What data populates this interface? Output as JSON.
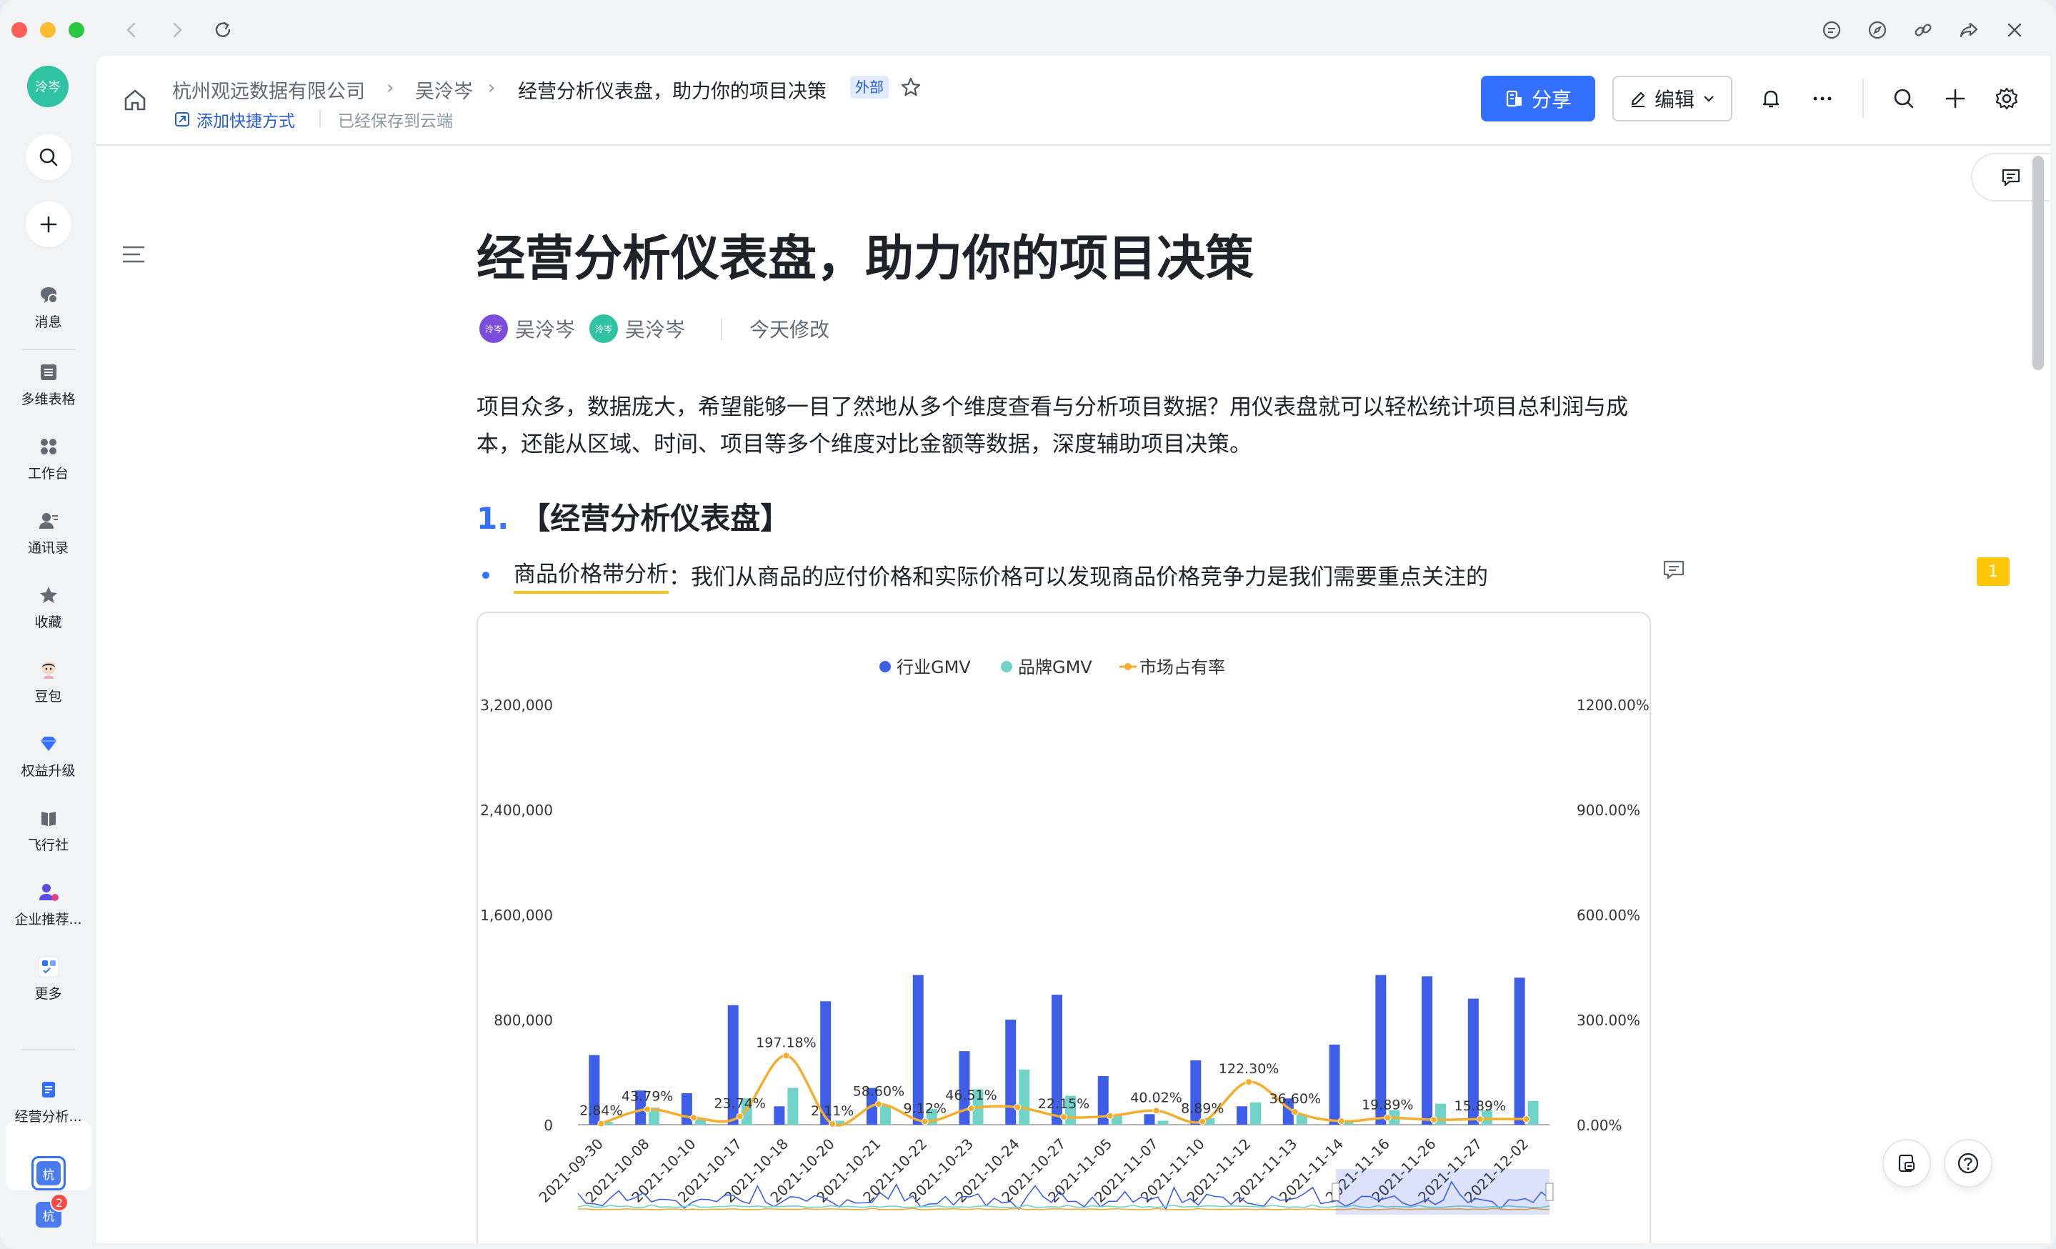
{
  "sidebar": {
    "avatar_text": "泠岑",
    "items": [
      {
        "label": "消息",
        "icon": "chat-bubble-icon"
      },
      {
        "label": "多维表格",
        "icon": "table-icon"
      },
      {
        "label": "工作台",
        "icon": "apps-grid-icon"
      },
      {
        "label": "通讯录",
        "icon": "contacts-icon"
      },
      {
        "label": "收藏",
        "icon": "star-icon"
      },
      {
        "label": "豆包",
        "icon": "doubao-avatar-icon"
      },
      {
        "label": "权益升级",
        "icon": "diamond-icon"
      },
      {
        "label": "飞行社",
        "icon": "book-icon"
      },
      {
        "label": "企业推荐...",
        "icon": "recommend-user-icon"
      },
      {
        "label": "更多",
        "icon": "more-apps-icon"
      }
    ],
    "active_doc": {
      "label": "经营分析...",
      "icon": "doc-icon"
    },
    "tenant_badges": [
      {
        "text": "杭",
        "count": ""
      },
      {
        "text": "杭",
        "count": "2"
      }
    ]
  },
  "header": {
    "breadcrumb": [
      "杭州观远数据有限公司",
      "吴泠岑",
      "经营分析仪表盘，助力你的项目决策"
    ],
    "tag": "外部",
    "add_shortcut": "添加快捷方式",
    "saved": "已经保存到云端",
    "share_label": "分享",
    "edit_label": "编辑"
  },
  "doc": {
    "title": "经营分析仪表盘，助力你的项目决策",
    "authors": [
      {
        "name": "吴泠岑",
        "avatar": "泠岑",
        "color": "#7c4ddb"
      },
      {
        "name": "吴泠岑",
        "avatar": "泠岑",
        "color": "#2fc3a4"
      }
    ],
    "modified": "今天修改",
    "paragraph": "项目众多，数据庞大，希望能够一目了然地从多个维度查看与分析项目数据？用仪表盘就可以轻松统计项目总利润与成本，还能从区域、时间、项目等多个维度对比金额等数据，深度辅助项目决策。",
    "heading_num": "1.",
    "heading": "【经营分析仪表盘】",
    "bullet_highlight": "商品价格带分析",
    "bullet_rest": "：我们从商品的应付价格和实际价格可以发现商品价格竞争力是我们需要重点关注的",
    "comment_count": "1"
  },
  "chart_data": {
    "type": "bar",
    "legend": [
      "行业GMV",
      "品牌GMV",
      "市场占有率"
    ],
    "colors": {
      "industry": "#3f5ee8",
      "brand": "#6fd3c7",
      "share": "#f5ad2c"
    },
    "categories": [
      "2021-09-30",
      "2021-10-08",
      "2021-10-10",
      "2021-10-17",
      "2021-10-18",
      "2021-10-20",
      "2021-10-21",
      "2021-10-22",
      "2021-10-23",
      "2021-10-24",
      "2021-10-27",
      "2021-11-05",
      "2021-11-07",
      "2021-11-10",
      "2021-11-12",
      "2021-11-13",
      "2021-11-14",
      "2021-11-16",
      "2021-11-26",
      "2021-11-27",
      "2021-12-02"
    ],
    "series": [
      {
        "name": "行业GMV",
        "axis": "left",
        "values": [
          530000,
          260000,
          240000,
          910000,
          140000,
          940000,
          280000,
          1140000,
          560000,
          800000,
          990000,
          370000,
          80000,
          490000,
          140000,
          200000,
          610000,
          1140000,
          1130000,
          960000,
          1120000
        ]
      },
      {
        "name": "品牌GMV",
        "axis": "left",
        "values": [
          20000,
          130000,
          50000,
          200000,
          280000,
          30000,
          150000,
          120000,
          270000,
          420000,
          220000,
          70000,
          30000,
          50000,
          170000,
          80000,
          30000,
          110000,
          160000,
          110000,
          180000
        ]
      },
      {
        "name": "市场占有率",
        "axis": "right",
        "type": "line",
        "values": [
          2.84,
          43.79,
          20,
          23.74,
          197.18,
          2.11,
          58.6,
          9.12,
          46.51,
          50,
          22.15,
          25,
          40.02,
          8.89,
          122.3,
          36.6,
          10,
          19.89,
          14,
          15.89,
          16
        ]
      }
    ],
    "share_labels": [
      "2.84%",
      "43.79%",
      "",
      "23.74%",
      "197.18%",
      "2.11%",
      "58.60%",
      "9.12%",
      "46.51%",
      "",
      "22.15%",
      "",
      "40.02%",
      "8.89%",
      "122.30%",
      "36.60%",
      "",
      "19.89%",
      "",
      "15.89%",
      ""
    ],
    "left_ticks": [
      "0",
      "800,000",
      "1,600,000",
      "2,400,000",
      "3,200,000"
    ],
    "right_ticks": [
      "0.00%",
      "300.00%",
      "600.00%",
      "900.00%",
      "1200.00%"
    ],
    "ylim_left": [
      0,
      3200000
    ],
    "ylim_right": [
      0,
      1200
    ]
  }
}
